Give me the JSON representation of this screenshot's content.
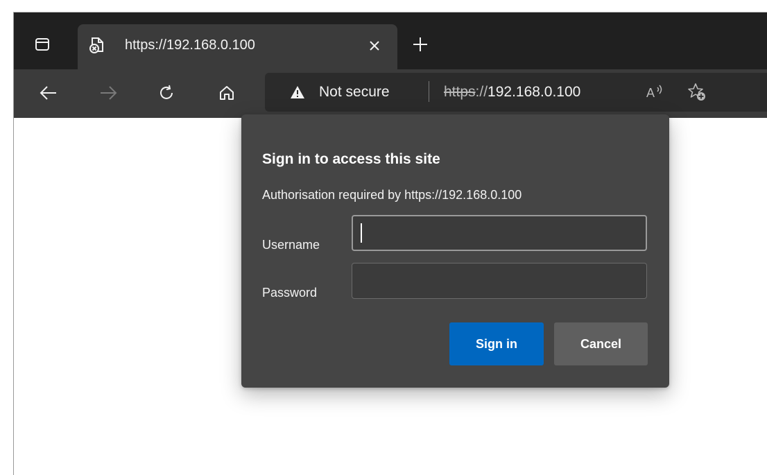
{
  "browser": {
    "tab": {
      "title": "https://192.168.0.100",
      "favicon": "insecure-page-icon",
      "close_icon": "close-icon"
    },
    "new_tab_icon": "plus-icon",
    "tab_actions_icon": "tab-actions-icon",
    "nav": {
      "back_icon": "arrow-left-icon",
      "forward_icon": "arrow-right-icon",
      "refresh_icon": "refresh-icon",
      "home_icon": "home-icon"
    },
    "address": {
      "warning_icon": "warning-triangle-icon",
      "security_label": "Not secure",
      "url_scheme": "https",
      "url_separator": "://",
      "url_host": "192.168.0.100",
      "read_aloud_icon": "read-aloud-icon",
      "favorites_icon": "add-favorite-icon"
    },
    "colors": {
      "tabstrip": "#202020",
      "toolbar": "#3b3b3b",
      "address_bar": "#2b2b2b",
      "dialog": "#454545",
      "primary_button": "#0067c0",
      "secondary_button": "#5f5f5f"
    }
  },
  "dialog": {
    "title": "Sign in to access this site",
    "message": "Authorisation required by https://192.168.0.100",
    "username_label": "Username",
    "username_value": "",
    "password_label": "Password",
    "password_value": "",
    "signin_label": "Sign in",
    "cancel_label": "Cancel"
  }
}
